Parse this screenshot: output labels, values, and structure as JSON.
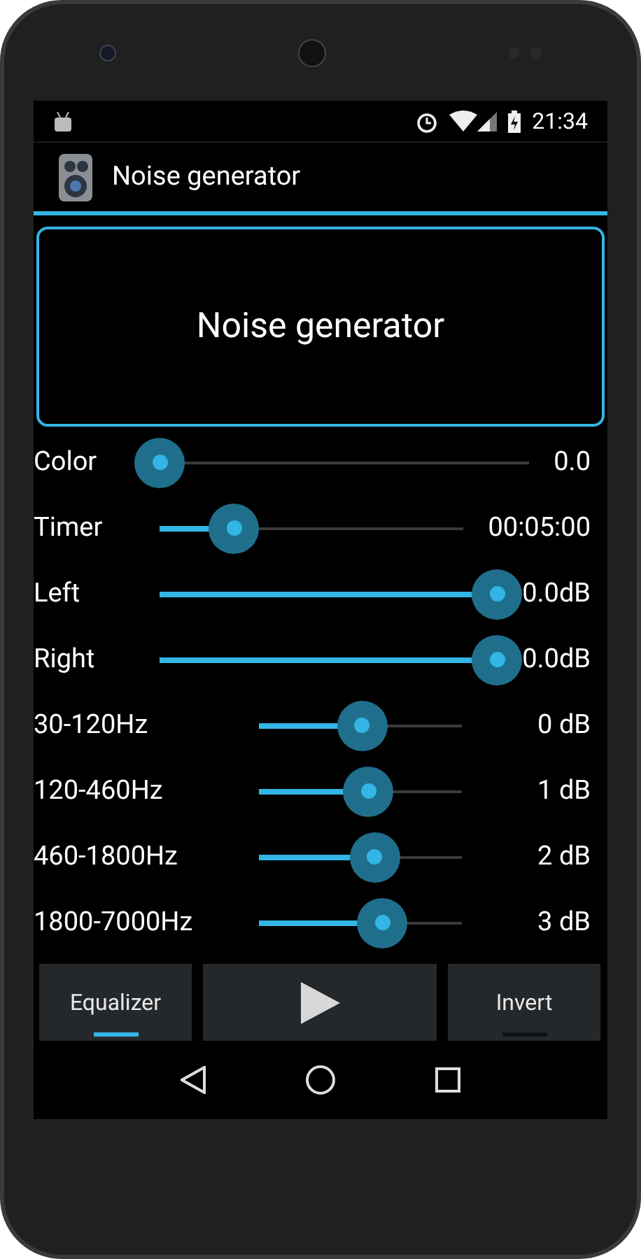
{
  "status_bar": {
    "time": "21:34"
  },
  "action_bar": {
    "title": "Noise generator"
  },
  "display": {
    "text": "Noise generator"
  },
  "sliders": [
    {
      "kind": "main",
      "label": "Color",
      "level": 0,
      "reading": "0.0"
    },
    {
      "kind": "main",
      "label": "Timer",
      "level": 0.245,
      "reading": "00:05:00"
    },
    {
      "kind": "main",
      "label": "Left",
      "level": 1,
      "reading": "0.0dB"
    },
    {
      "kind": "main",
      "label": "Right",
      "level": 1,
      "reading": "0.0dB"
    },
    {
      "kind": "band",
      "label": "30-120Hz",
      "level": 0.51,
      "reading": "0 dB"
    },
    {
      "kind": "band",
      "label": "120-460Hz",
      "level": 0.54,
      "reading": "1 dB"
    },
    {
      "kind": "band",
      "label": "460-1800Hz",
      "level": 0.57,
      "reading": "2 dB"
    },
    {
      "kind": "band",
      "label": "1800-7000Hz",
      "level": 0.61,
      "reading": "3 dB"
    }
  ],
  "buttons": [
    {
      "kind": "toggle",
      "label": "Equalizer",
      "on": true
    },
    {
      "kind": "play"
    },
    {
      "kind": "toggle",
      "label": "Invert",
      "on": false
    }
  ]
}
